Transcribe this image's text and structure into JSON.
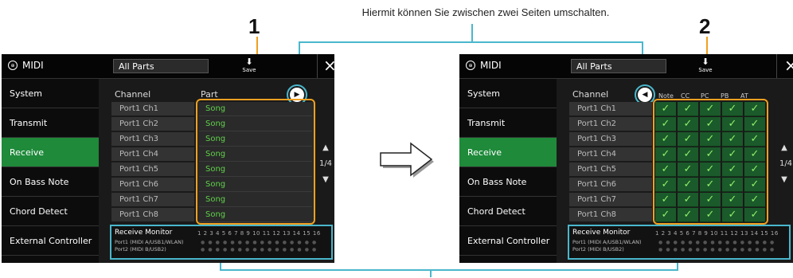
{
  "caption": "Hiermit können Sie zwischen zwei Seiten umschalten.",
  "callouts": {
    "one": "1",
    "two": "2"
  },
  "panel": {
    "title": "MIDI",
    "logo_icon": "midi-logo-icon",
    "part_select": "All Parts",
    "save_label": "Save",
    "close_icon": "close-icon",
    "sidebar": [
      "System",
      "Transmit",
      "Receive",
      "On Bass Note",
      "Chord Detect",
      "External Controller"
    ],
    "active_sidebar": "Receive",
    "col_channel": "Channel",
    "col_part": "Part",
    "channels": [
      "Port1 Ch1",
      "Port1 Ch2",
      "Port1 Ch3",
      "Port1 Ch4",
      "Port1 Ch5",
      "Port1 Ch6",
      "Port1 Ch7",
      "Port1 Ch8"
    ],
    "part_values": [
      "Song",
      "Song",
      "Song",
      "Song",
      "Song",
      "Song",
      "Song",
      "Song"
    ],
    "msg_headers": [
      "Note",
      "CC",
      "PC",
      "PB",
      "AT"
    ],
    "checkmark": "✓",
    "page": "1/4",
    "page_up_icon": "▲",
    "page_down_icon": "▼",
    "next_page_icon": "▶",
    "prev_page_icon": "◀",
    "monitor": {
      "title": "Receive Monitor",
      "port1": "Port1 (MIDI A/USB1/WLAN)",
      "port2": "Port2 (MIDI B/USB2)",
      "numbers": "1 2 3 4 5 6 7 8 9 10 11 12 13 14 15 16"
    }
  },
  "colors": {
    "active": "#1e8a3a",
    "highlight_orange": "#f0a020",
    "highlight_cyan": "#49b7cc",
    "song_green": "#5fd04a"
  }
}
